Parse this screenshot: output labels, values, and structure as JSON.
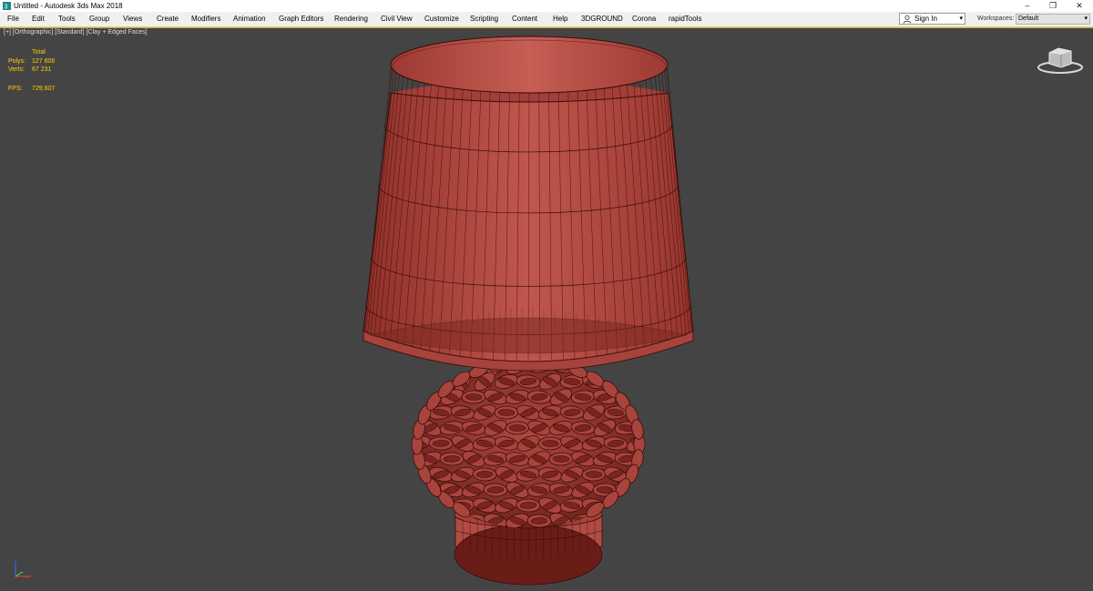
{
  "window": {
    "title": "Untitled - Autodesk 3ds Max 2018",
    "controls": [
      "–",
      "❐",
      "✕"
    ]
  },
  "menu": [
    "File",
    "Edit",
    "Tools",
    "Group",
    "Views",
    "Create",
    "Modifiers",
    "Animation",
    "Graph Editors",
    "Rendering",
    "Civil View",
    "Customize",
    "Scripting",
    "Content",
    "Help",
    "3DGROUND",
    "Corona",
    "rapidTools"
  ],
  "account": {
    "sign_in": "Sign In",
    "dropdown": "▾"
  },
  "workspaces": {
    "label": "Workspaces:",
    "value": "Default",
    "dropdown": "▾"
  },
  "viewport": {
    "label": "[+] [Orthographic] [Standard] [Clay + Edged Faces]",
    "stats": {
      "total_header": "Total",
      "polys_label": "Polys:",
      "polys_value": "127 606",
      "verts_label": "Verts:",
      "verts_value": "67 231",
      "fps_label": "FPS:",
      "fps_value": "729,607"
    },
    "colors": {
      "background": "#444444",
      "model_fill": "#b85048",
      "model_dark": "#7a2420",
      "wire": "#3a0c0a",
      "stat_text": "#ffd000",
      "active_border": "#e0b400"
    }
  },
  "icons": {
    "app": "3ds-max-logo-icon",
    "user": "person-icon",
    "viewcube": "viewcube-icon",
    "axis": "axis-tripod-icon"
  }
}
